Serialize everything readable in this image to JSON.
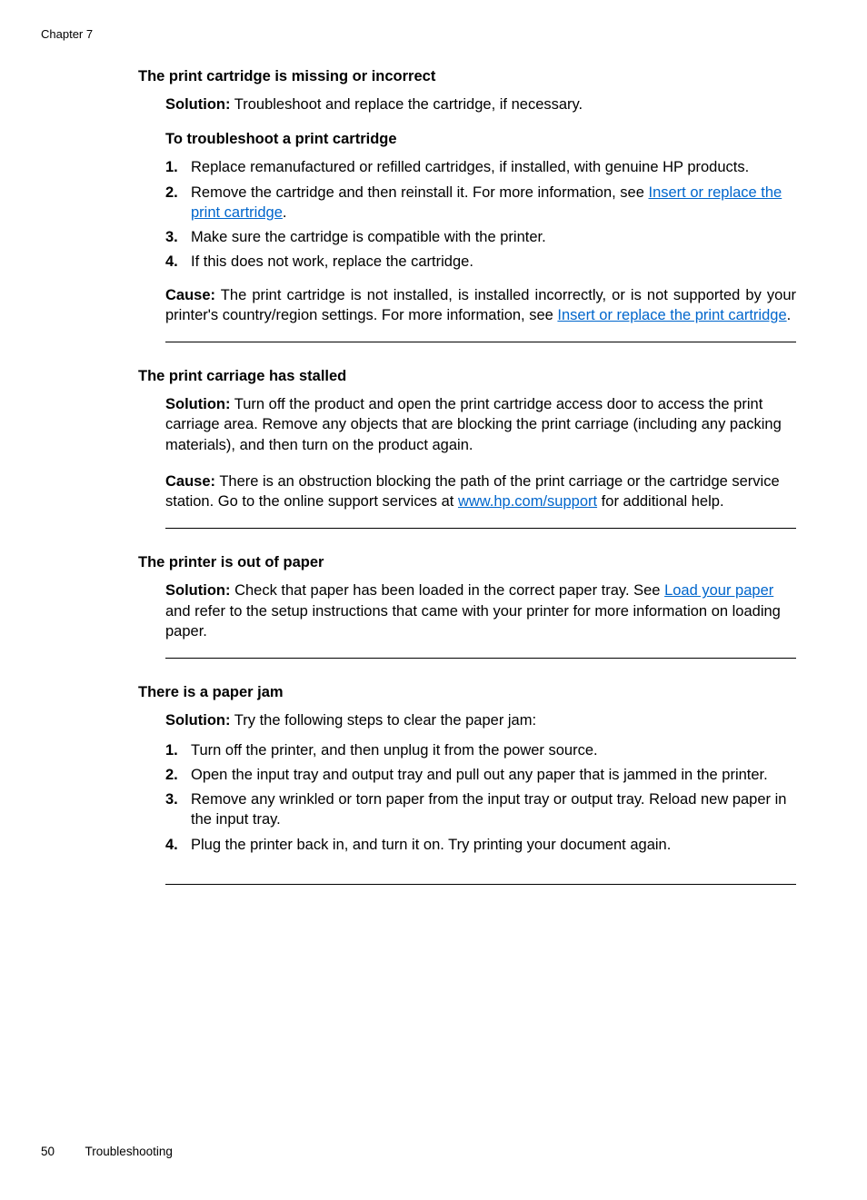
{
  "header": {
    "chapter": "Chapter 7"
  },
  "sections": {
    "s1": {
      "heading": "The print cartridge is missing or incorrect",
      "solution_label": "Solution:",
      "solution_text": "   Troubleshoot and replace the cartridge, if necessary.",
      "sub_heading": "To troubleshoot a print cartridge",
      "steps": {
        "n1": "1.",
        "t1": "Replace remanufactured or refilled cartridges, if installed, with genuine HP products.",
        "n2": "2.",
        "t2a": "Remove the cartridge and then reinstall it. For more information, see ",
        "t2_link": "Insert or replace the print cartridge",
        "t2b": ".",
        "n3": "3.",
        "t3": "Make sure the cartridge is compatible with the printer.",
        "n4": "4.",
        "t4": "If this does not work, replace the cartridge."
      },
      "cause_label": "Cause:",
      "cause_text_a": "   The print cartridge is not installed, is installed incorrectly, or is not supported by your printer's country/region settings. For more information, see ",
      "cause_link": "Insert or replace the print cartridge",
      "cause_text_b": "."
    },
    "s2": {
      "heading": "The print carriage has stalled",
      "solution_label": "Solution:",
      "solution_text": "   Turn off the product and open the print cartridge access door to access the print carriage area. Remove any objects that are blocking the print carriage (including any packing materials), and then turn on the product again.",
      "cause_label": "Cause:",
      "cause_text_a": "   There is an obstruction blocking the path of the print carriage or the cartridge service station. Go to the online support services at ",
      "cause_link": "www.hp.com/support",
      "cause_text_b": " for additional help."
    },
    "s3": {
      "heading": "The printer is out of paper",
      "solution_label": "Solution:",
      "solution_text_a": "   Check that paper has been loaded in the correct paper tray. See ",
      "solution_link": "Load your paper",
      "solution_text_b": " and refer to the setup instructions that came with your printer for more information on loading paper."
    },
    "s4": {
      "heading": "There is a paper jam",
      "solution_label": "Solution:",
      "solution_text": "   Try the following steps to clear the paper jam:",
      "steps": {
        "n1": "1.",
        "t1": "Turn off the printer, and then unplug it from the power source.",
        "n2": "2.",
        "t2": "Open the input tray and output tray and pull out any paper that is jammed in the printer.",
        "n3": "3.",
        "t3": "Remove any wrinkled or torn paper from the input tray or output tray. Reload new paper in the input tray.",
        "n4": "4.",
        "t4": "Plug the printer back in, and turn it on. Try printing your document again."
      }
    }
  },
  "footer": {
    "page_number": "50",
    "section": "Troubleshooting"
  }
}
